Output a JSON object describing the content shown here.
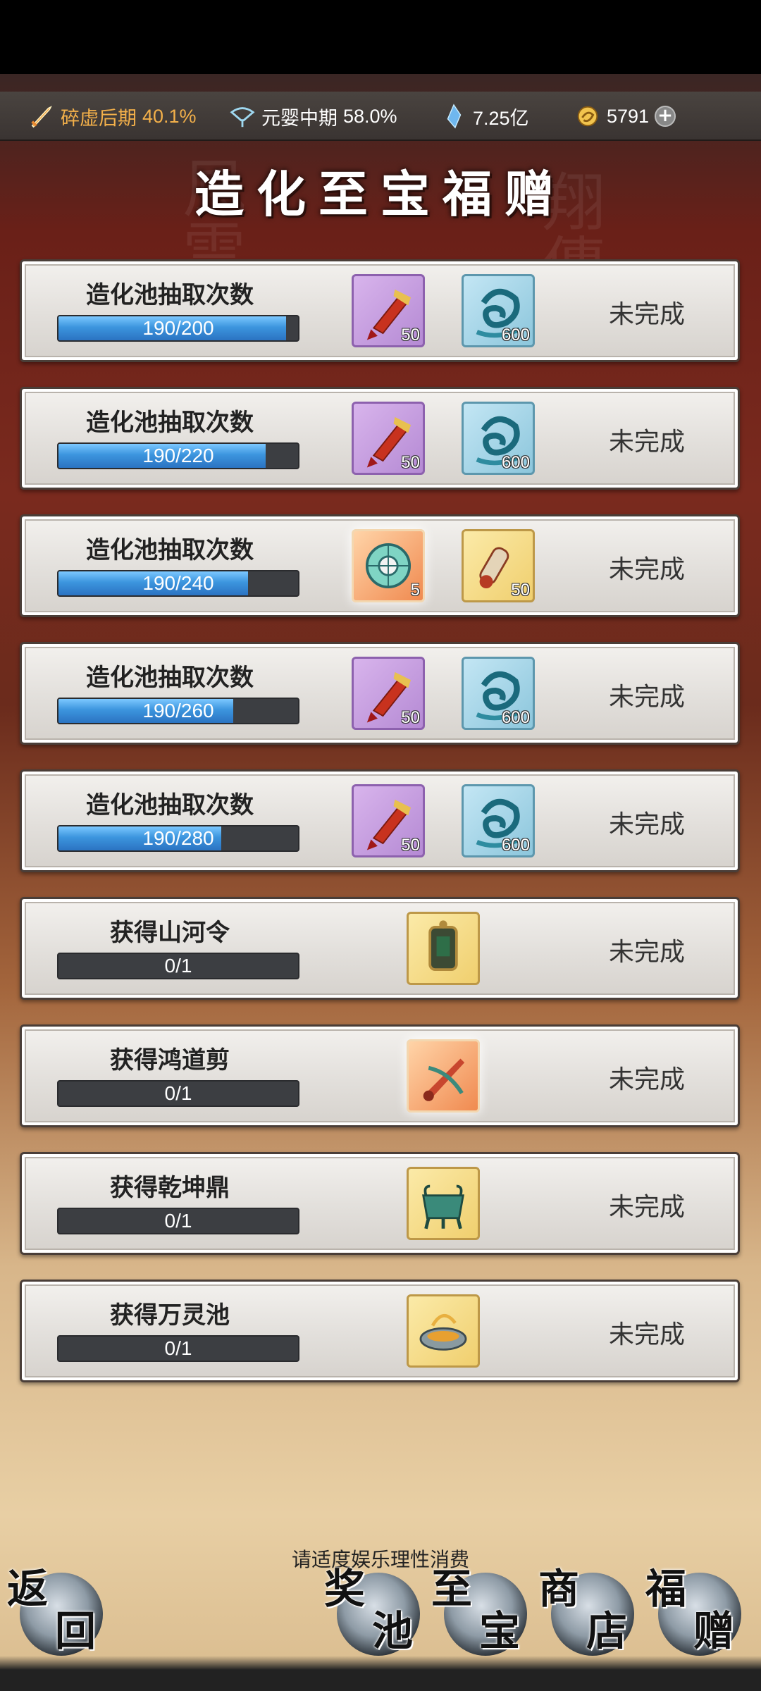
{
  "resources": [
    {
      "name": "碎虚后期",
      "value": "40.1%",
      "icon": "sword-icon"
    },
    {
      "name": "元婴中期",
      "value": "58.0%",
      "icon": "fan-icon"
    },
    {
      "name": "",
      "value": "7.25亿",
      "icon": "crystal-icon"
    },
    {
      "name": "",
      "value": "5791",
      "icon": "coin-icon"
    }
  ],
  "title": "造化至宝福赠",
  "tasks": [
    {
      "label": "造化池抽取次数",
      "progress": "190/200",
      "fraction": 0.95,
      "status": "未完成",
      "rewards": [
        {
          "style": "purple",
          "icon": "scroll-icon",
          "qty": "50"
        },
        {
          "style": "blue",
          "icon": "water-swirl-icon",
          "qty": "600"
        }
      ]
    },
    {
      "label": "造化池抽取次数",
      "progress": "190/220",
      "fraction": 0.8636,
      "status": "未完成",
      "rewards": [
        {
          "style": "purple",
          "icon": "scroll-icon",
          "qty": "50"
        },
        {
          "style": "blue",
          "icon": "water-swirl-icon",
          "qty": "600"
        }
      ]
    },
    {
      "label": "造化池抽取次数",
      "progress": "190/240",
      "fraction": 0.7917,
      "status": "未完成",
      "rewards": [
        {
          "style": "orange",
          "icon": "jade-disc-icon",
          "qty": "5"
        },
        {
          "style": "gold",
          "icon": "scroll-bundle-icon",
          "qty": "50"
        }
      ]
    },
    {
      "label": "造化池抽取次数",
      "progress": "190/260",
      "fraction": 0.7308,
      "status": "未完成",
      "rewards": [
        {
          "style": "purple",
          "icon": "scroll-icon",
          "qty": "50"
        },
        {
          "style": "blue",
          "icon": "water-swirl-icon",
          "qty": "600"
        }
      ]
    },
    {
      "label": "造化池抽取次数",
      "progress": "190/280",
      "fraction": 0.6786,
      "status": "未完成",
      "rewards": [
        {
          "style": "purple",
          "icon": "scroll-icon",
          "qty": "50"
        },
        {
          "style": "blue",
          "icon": "water-swirl-icon",
          "qty": "600"
        }
      ]
    },
    {
      "label": "获得山河令",
      "progress": "0/1",
      "fraction": 0,
      "status": "未完成",
      "rewards": [
        {
          "style": "gold",
          "icon": "token-icon",
          "qty": ""
        }
      ]
    },
    {
      "label": "获得鸿道剪",
      "progress": "0/1",
      "fraction": 0,
      "status": "未完成",
      "rewards": [
        {
          "style": "orange",
          "icon": "shears-icon",
          "qty": ""
        }
      ]
    },
    {
      "label": "获得乾坤鼎",
      "progress": "0/1",
      "fraction": 0,
      "status": "未完成",
      "rewards": [
        {
          "style": "gold",
          "icon": "cauldron-icon",
          "qty": ""
        }
      ]
    },
    {
      "label": "获得万灵池",
      "progress": "0/1",
      "fraction": 0,
      "status": "未完成",
      "rewards": [
        {
          "style": "gold",
          "icon": "pool-icon",
          "qty": ""
        }
      ]
    }
  ],
  "notice": "请适度娱乐理性消费",
  "nav": {
    "back": {
      "c1": "返",
      "c2": "回"
    },
    "pool": {
      "c1": "奖",
      "c2": "池"
    },
    "treasure": {
      "c1": "至",
      "c2": "宝"
    },
    "shop": {
      "c1": "商",
      "c2": "店"
    },
    "gift": {
      "c1": "福",
      "c2": "赠"
    }
  }
}
